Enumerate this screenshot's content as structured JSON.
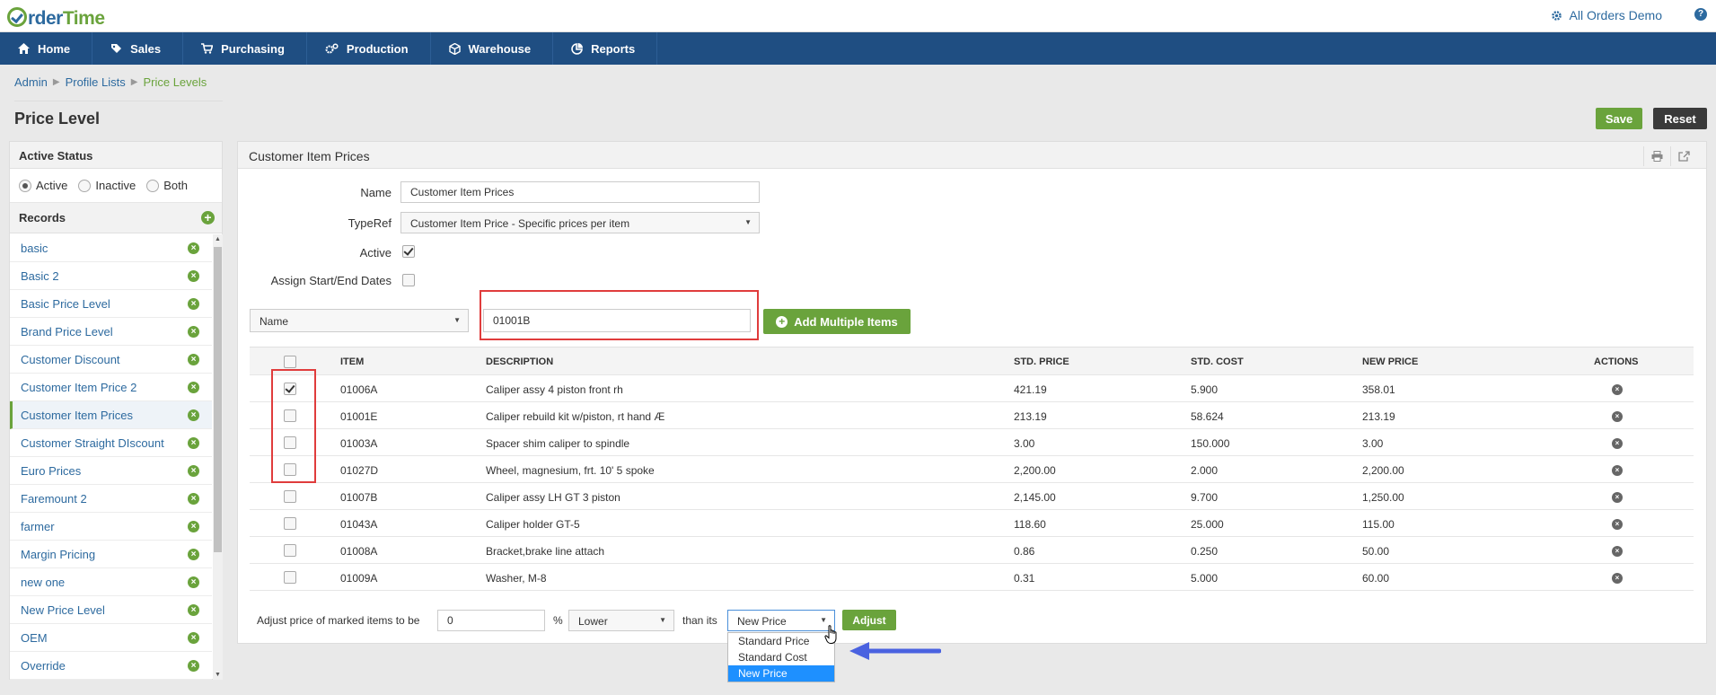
{
  "app": {
    "logo_left": "rder",
    "logo_right": "Time",
    "company": "All Orders Demo",
    "help": "?"
  },
  "nav": [
    "Home",
    "Sales",
    "Purchasing",
    "Production",
    "Warehouse",
    "Reports"
  ],
  "breadcrumb": [
    "Admin",
    "Profile Lists",
    "Price Levels"
  ],
  "page": {
    "title": "Price Level",
    "save": "Save",
    "reset": "Reset"
  },
  "left": {
    "status_title": "Active Status",
    "status_options": [
      "Active",
      "Inactive",
      "Both"
    ],
    "status_selected": "Active",
    "records_title": "Records",
    "records": [
      "basic",
      "Basic 2",
      "Basic Price Level",
      "Brand Price Level",
      "Customer Discount",
      "Customer Item Price 2",
      "Customer Item Prices",
      "Customer Straight DIscount",
      "Euro Prices",
      "Faremount 2",
      "farmer",
      "Margin Pricing",
      "new one",
      "New Price Level",
      "OEM",
      "Override"
    ],
    "selected_record": "Customer Item Prices"
  },
  "main": {
    "panel_title": "Customer Item Prices",
    "name_label": "Name",
    "name_value": "Customer Item Prices",
    "typeref_label": "TypeRef",
    "typeref_value": "Customer Item Price - Specific prices per item",
    "active_label": "Active",
    "active_checked": true,
    "dates_label": "Assign Start/End Dates",
    "dates_checked": false,
    "search_field": "Name",
    "search_value": "01001B",
    "add_multiple": "Add Multiple Items"
  },
  "table": {
    "headers": [
      "ITEM",
      "DESCRIPTION",
      "STD. PRICE",
      "STD. COST",
      "NEW PRICE",
      "ACTIONS"
    ],
    "rows": [
      {
        "checked": true,
        "item": "01006A",
        "desc": "Caliper assy 4 piston front rh",
        "std_price": "421.19",
        "std_cost": "5.900",
        "new_price": "358.01"
      },
      {
        "checked": false,
        "item": "01001E",
        "desc": "Caliper rebuild kit w/piston, rt hand Æ",
        "std_price": "213.19",
        "std_cost": "58.624",
        "new_price": "213.19"
      },
      {
        "checked": false,
        "item": "01003A",
        "desc": "Spacer shim caliper to spindle",
        "std_price": "3.00",
        "std_cost": "150.000",
        "new_price": "3.00"
      },
      {
        "checked": false,
        "item": "01027D",
        "desc": "Wheel, magnesium, frt. 10' 5 spoke",
        "std_price": "2,200.00",
        "std_cost": "2.000",
        "new_price": "2,200.00"
      },
      {
        "checked": false,
        "item": "01007B",
        "desc": "Caliper assy LH GT 3 piston",
        "std_price": "2,145.00",
        "std_cost": "9.700",
        "new_price": "1,250.00"
      },
      {
        "checked": false,
        "item": "01043A",
        "desc": "Caliper holder GT-5",
        "std_price": "118.60",
        "std_cost": "25.000",
        "new_price": "115.00"
      },
      {
        "checked": false,
        "item": "01008A",
        "desc": "Bracket,brake line attach",
        "std_price": "0.86",
        "std_cost": "0.250",
        "new_price": "50.00"
      },
      {
        "checked": false,
        "item": "01009A",
        "desc": "Washer, M-8",
        "std_price": "0.31",
        "std_cost": "5.000",
        "new_price": "60.00"
      }
    ]
  },
  "adjust": {
    "label": "Adjust price of marked items to be",
    "value": "0",
    "percent": "%",
    "direction": "Lower",
    "than_its": "than its",
    "basis": "New Price",
    "button": "Adjust",
    "options": [
      "Standard Price",
      "Standard Cost",
      "New Price"
    ],
    "highlighted": "New Price"
  },
  "colors": {
    "nav": "#1f4e82",
    "accent_green": "#6aa33c",
    "link_blue": "#2d6a9f",
    "annotation_red": "#e03c3c",
    "annotation_arrow": "#4a62e0"
  }
}
